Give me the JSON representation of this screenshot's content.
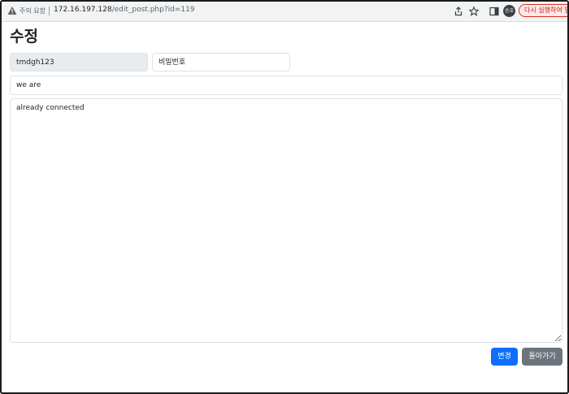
{
  "browser": {
    "security_label": "주의 요함",
    "url_host": "172.16.197.128",
    "url_path": "/edit_post.php?id=119",
    "avatar_text": "승호",
    "relaunch_label": "다시 실행하여 업"
  },
  "page": {
    "title": "수정"
  },
  "form": {
    "writer_value": "tmdgh123",
    "password_placeholder": "비밀번호",
    "title_value": "we are",
    "content_value": "already connected",
    "submit_label": "변경",
    "back_label": "돌아가기"
  },
  "colors": {
    "primary": "#0d6efd",
    "secondary": "#6c757d",
    "readonly_bg": "#e9ecef",
    "relaunch_red": "#d93025"
  }
}
